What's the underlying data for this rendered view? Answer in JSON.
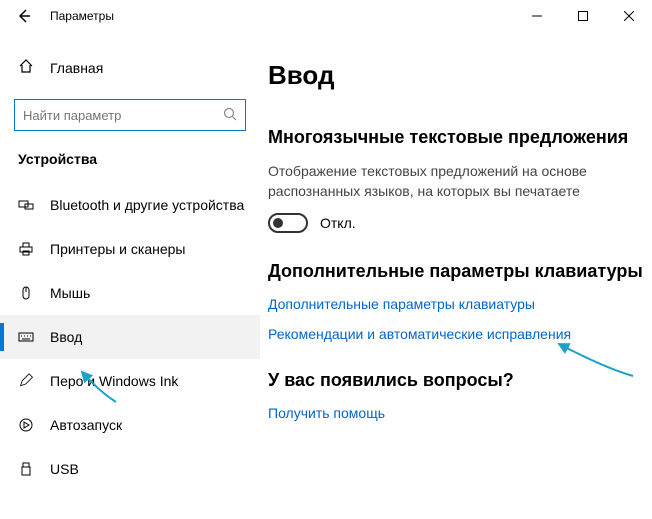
{
  "window": {
    "title": "Параметры"
  },
  "sidebar": {
    "home": "Главная",
    "search_placeholder": "Найти параметр",
    "section": "Устройства",
    "items": [
      {
        "label": "Bluetooth и другие устройства"
      },
      {
        "label": "Принтеры и сканеры"
      },
      {
        "label": "Мышь"
      },
      {
        "label": "Ввод"
      },
      {
        "label": "Перо и Windows Ink"
      },
      {
        "label": "Автозапуск"
      },
      {
        "label": "USB"
      }
    ]
  },
  "main": {
    "page_title": "Ввод",
    "section1_title": "Многоязычные текстовые предложения",
    "section1_desc": "Отображение текстовых предложений на основе распознанных языков, на которых вы печатаете",
    "toggle_label": "Откл.",
    "section2_title": "Дополнительные параметры клавиатуры",
    "link1": "Дополнительные параметры клавиатуры",
    "link2": "Рекомендации и автоматические исправления",
    "section3_title": "У вас появились вопросы?",
    "link3": "Получить помощь"
  }
}
